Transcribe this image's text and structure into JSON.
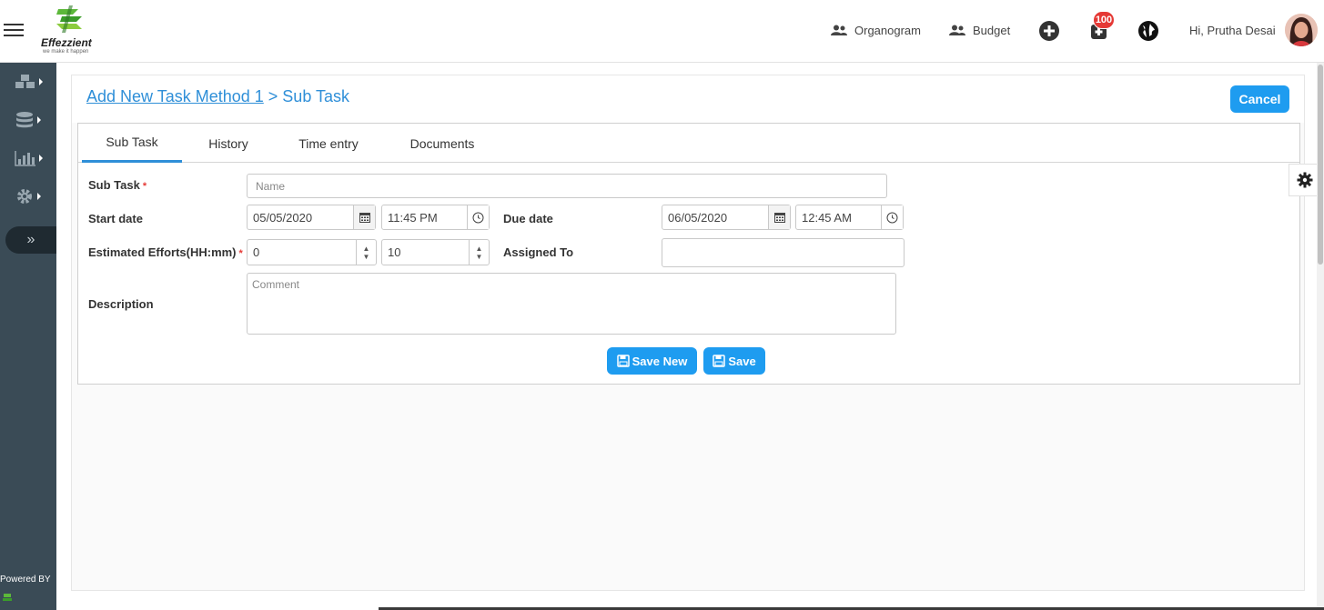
{
  "header": {
    "logo_text": "Effezzient",
    "logo_tagline": "we make it happen",
    "nav": [
      {
        "label": "Organogram",
        "icon": "users-icon"
      },
      {
        "label": "Budget",
        "icon": "users-icon"
      }
    ],
    "add_icon": "plus-circle-icon",
    "notification_icon": "bell-icon",
    "notification_count": "100",
    "globe_icon": "globe-icon",
    "greeting": "Hi, Prutha Desai"
  },
  "sidebar": {
    "items": [
      {
        "icon": "cubes-icon"
      },
      {
        "icon": "database-icon"
      },
      {
        "icon": "bar-chart-icon"
      },
      {
        "icon": "gear-icon"
      }
    ],
    "expand_label": "»",
    "powered_by": "Powered BY"
  },
  "page": {
    "breadcrumb_link": "Add New Task Method 1",
    "breadcrumb_separator": " > ",
    "breadcrumb_current": "Sub Task",
    "cancel_label": "Cancel"
  },
  "tabs": [
    {
      "label": "Sub Task",
      "active": true
    },
    {
      "label": "History",
      "active": false
    },
    {
      "label": "Time entry",
      "active": false
    },
    {
      "label": "Documents",
      "active": false
    }
  ],
  "form": {
    "subtask_label": "Sub Task",
    "required_mark": "*",
    "name_placeholder": "Name",
    "start_date_label": "Start date",
    "start_date": "05/05/2020",
    "start_time": "11:45 PM",
    "due_date_label": "Due date",
    "due_date": "06/05/2020",
    "due_time": "12:45 AM",
    "efforts_label": "Estimated Efforts(HH:mm)",
    "efforts_hours": "0",
    "efforts_minutes": "10",
    "assigned_label": "Assigned To",
    "assigned_value": "",
    "description_label": "Description",
    "comment_placeholder": "Comment",
    "save_new_label": "Save New",
    "save_label": "Save"
  },
  "colors": {
    "accent": "#1e9cf0",
    "link": "#2f8fd8",
    "sidebar": "#3a4b56",
    "badge": "#e53935"
  }
}
